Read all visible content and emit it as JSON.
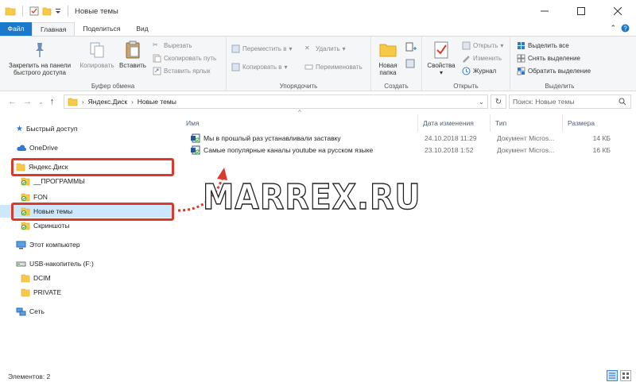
{
  "window": {
    "title": "Новые темы",
    "controls": [
      "minimize",
      "maximize",
      "close"
    ]
  },
  "ribbon_tabs": [
    {
      "label": "Файл"
    },
    {
      "label": "Главная"
    },
    {
      "label": "Поделиться"
    },
    {
      "label": "Вид"
    }
  ],
  "ribbon": {
    "clipboard": {
      "label": "Буфер обмена",
      "pin": "Закрепить на панели быстрого доступа",
      "copy": "Копировать",
      "paste": "Вставить",
      "cut": "Вырезать",
      "copy_path": "Скопировать путь",
      "paste_shortcut": "Вставить ярлык"
    },
    "organize": {
      "label": "Упорядочить",
      "move_to": "Переместить в",
      "copy_to": "Копировать в",
      "delete": "Удалить",
      "rename": "Переименовать"
    },
    "create": {
      "label": "Создать",
      "new_folder": "Новая папка"
    },
    "open": {
      "label": "Открыть",
      "properties": "Свойства",
      "open": "Открыть",
      "edit": "Изменить",
      "history": "Журнал"
    },
    "select": {
      "label": "Выделить",
      "select_all": "Выделить все",
      "select_none": "Снять выделение",
      "invert": "Обратить выделение"
    }
  },
  "address": {
    "segments": [
      "Яндекс.Диск",
      "Новые темы"
    ],
    "search_placeholder": "Поиск: Новые темы"
  },
  "nav": {
    "quick_access": "Быстрый доступ",
    "onedrive": "OneDrive",
    "yandex": "Яндекс.Диск",
    "programs": "__ПРОГРАММЫ",
    "fon": "FON",
    "new_themes": "Новые темы",
    "screenshots": "Скриншоты",
    "this_pc": "Этот компьютер",
    "usb": "USB-накопитель (F:)",
    "dcim": "DCIM",
    "private": "PRIVATE",
    "network": "Сеть"
  },
  "columns": {
    "name": "Имя",
    "date": "Дата изменения",
    "type": "Тип",
    "size": "Размера"
  },
  "files": [
    {
      "name": "Мы  в прошлый раз устанавливали заставку",
      "date": "24.10.2018 11:29",
      "type": "Документ Micros...",
      "size": "14 КБ"
    },
    {
      "name": "Самые популярные каналы youtube на русском языке",
      "date": "23.10.2018 1:52",
      "type": "Документ Micros...",
      "size": "16 КБ"
    }
  ],
  "watermark": "MARREX.RU",
  "status": {
    "items": "Элементов: 2"
  },
  "colors": {
    "file_tab": "#1979ca",
    "selection": "#cce8ff",
    "callout": "#d93a2b",
    "folder": "#f7c948"
  }
}
